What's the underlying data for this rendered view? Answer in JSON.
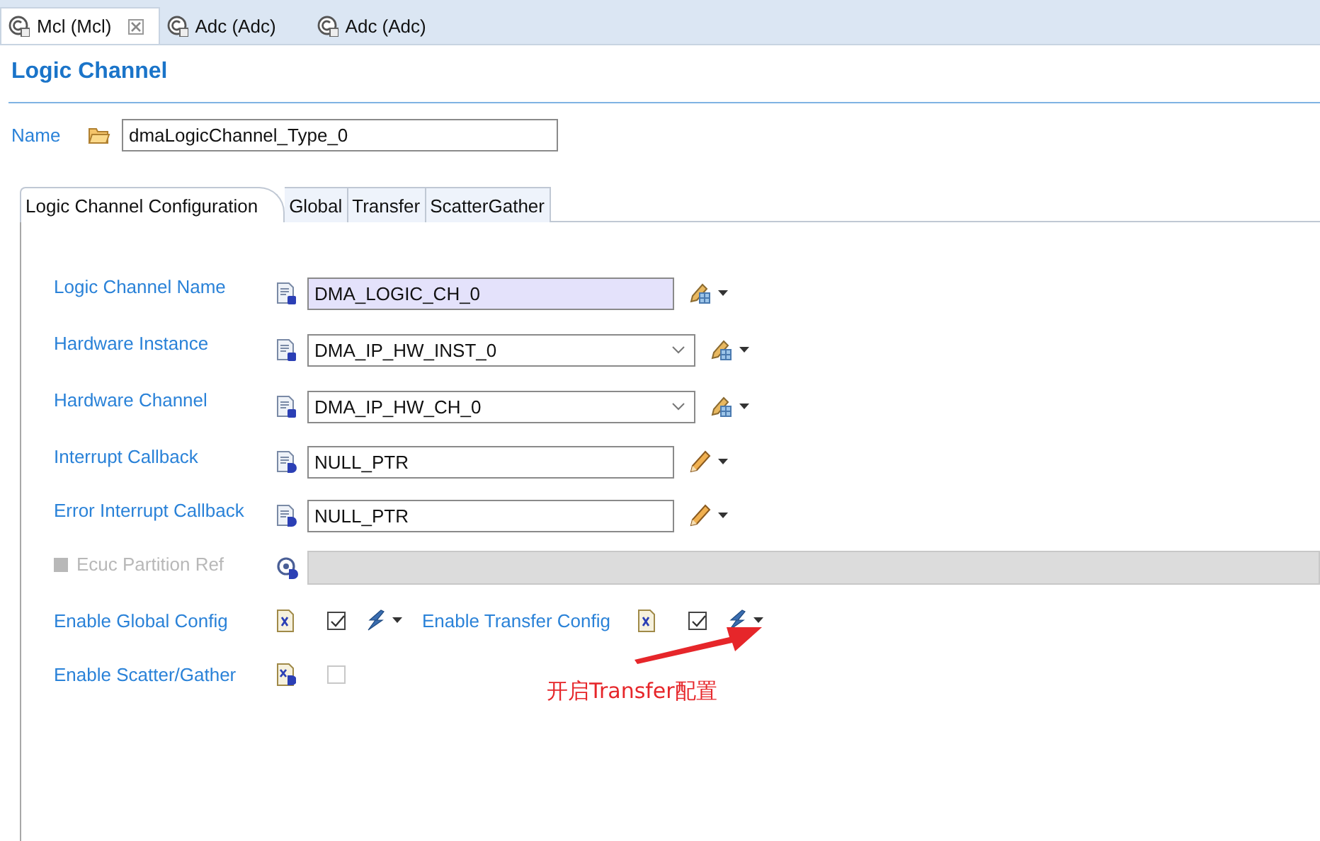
{
  "editor_tabs": [
    {
      "label": "Mcl (Mcl)",
      "selected": true
    },
    {
      "label": "Adc (Adc)",
      "selected": false
    },
    {
      "label": "Adc (Adc)",
      "selected": false
    }
  ],
  "header": {
    "title": "Logic Channel"
  },
  "name": {
    "label": "Name",
    "value": "dmaLogicChannel_Type_0"
  },
  "config_tabs": [
    {
      "label": "Logic Channel Configuration",
      "selected": true
    },
    {
      "label": "Global",
      "selected": false
    },
    {
      "label": "Transfer",
      "selected": false
    },
    {
      "label": "ScatterGather",
      "selected": false
    }
  ],
  "fields": [
    {
      "kind": "calculated",
      "label": "Logic Channel Name",
      "value": "DMA_LOGIC_CH_0"
    },
    {
      "kind": "combo",
      "label": "Hardware Instance",
      "value": "DMA_IP_HW_INST_0"
    },
    {
      "kind": "combo",
      "label": "Hardware Channel",
      "value": "DMA_IP_HW_CH_0"
    },
    {
      "kind": "text",
      "label": "Interrupt Callback",
      "value": "NULL_PTR"
    },
    {
      "kind": "text",
      "label": "Error Interrupt Callback",
      "value": "NULL_PTR"
    },
    {
      "kind": "reference",
      "label": "Ecuc Partition Ref",
      "checked": false,
      "disabled": true
    }
  ],
  "boolean_rows": [
    [
      {
        "label": "Enable Global Config",
        "checked": true,
        "disabled": false
      },
      {
        "label": "Enable Transfer Config",
        "checked": true,
        "disabled": false
      }
    ],
    [
      {
        "label": "Enable Scatter/Gather",
        "checked": false,
        "disabled": true
      }
    ]
  ],
  "annotation": {
    "text": "开启Transfer配置"
  }
}
